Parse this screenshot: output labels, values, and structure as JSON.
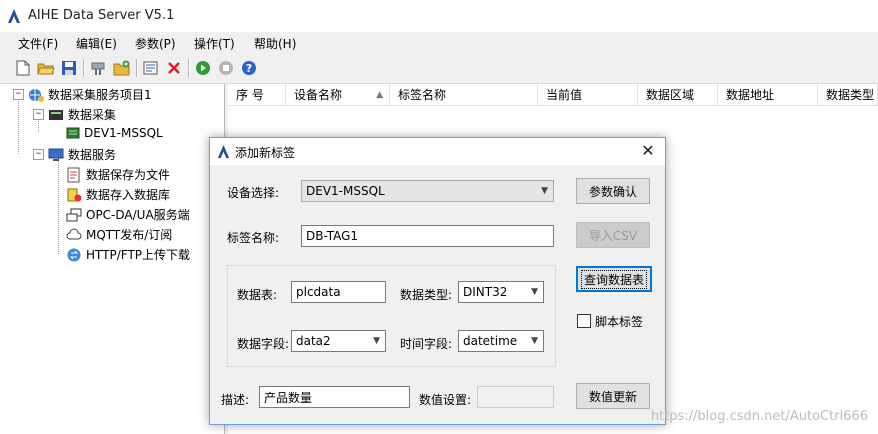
{
  "app": {
    "title": "AIHE Data Server V5.1"
  },
  "menu": [
    {
      "label": "文件(F)"
    },
    {
      "label": "编辑(E)"
    },
    {
      "label": "参数(P)"
    },
    {
      "label": "操作(T)"
    },
    {
      "label": "帮助(H)"
    }
  ],
  "toolbar": {
    "icons": [
      "new-file-icon",
      "open-folder-icon",
      "save-icon",
      "tool-icon",
      "folder-add-icon",
      "properties-icon",
      "delete-icon",
      "start-icon",
      "stop-icon",
      "help-icon"
    ]
  },
  "tree": {
    "root": "数据采集服务项目1",
    "collect": "数据采集",
    "device": "DEV1-MSSQL",
    "service": "数据服务",
    "services": [
      {
        "label": "数据保存为文件"
      },
      {
        "label": "数据存入数据库"
      },
      {
        "label": "OPC-DA/UA服务端"
      },
      {
        "label": "MQTT发布/订阅"
      },
      {
        "label": "HTTP/FTP上传下载"
      }
    ]
  },
  "table": {
    "columns": [
      "序 号",
      "设备名称",
      "标签名称",
      "当前值",
      "数据区域",
      "数据地址",
      "数据类型"
    ]
  },
  "dialog": {
    "title": "添加新标签",
    "close": "✕",
    "device_label": "设备选择:",
    "device_value": "DEV1-MSSQL",
    "tag_label": "标签名称:",
    "tag_value": "DB-TAG1",
    "table_label": "数据表:",
    "table_value": "plcdata",
    "dtype_label": "数据类型:",
    "dtype_value": "DINT32",
    "field_label": "数据字段:",
    "field_value": "data2",
    "time_label": "时间字段:",
    "time_value": "datetime",
    "desc_label": "描述:",
    "desc_value": "产品数量",
    "valset_label": "数值设置:",
    "valset_value": "",
    "btn_confirm": "参数确认",
    "btn_import": "导入CSV",
    "btn_query": "查询数据表",
    "script_label": "脚本标签",
    "script_checked": false,
    "btn_update": "数值更新"
  },
  "watermark": "https://blog.csdn.net/AutoCtrl666"
}
